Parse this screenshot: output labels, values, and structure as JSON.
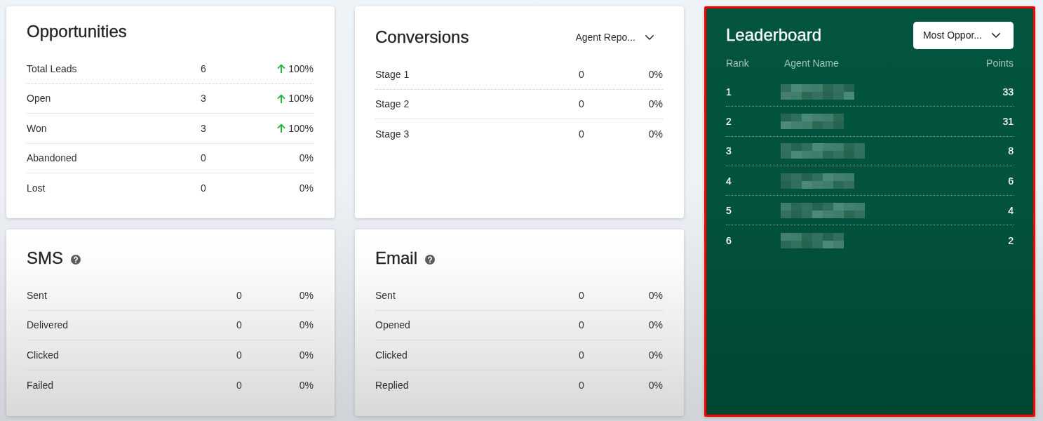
{
  "cards": [
    {
      "kind": "stats",
      "title": "Opportunities",
      "help": false,
      "rows": [
        {
          "label": "Total Leads",
          "count": "6",
          "percent": "100%",
          "trend_up": true
        },
        {
          "label": "Open",
          "count": "3",
          "percent": "100%",
          "trend_up": true
        },
        {
          "label": "Won",
          "count": "3",
          "percent": "100%",
          "trend_up": true
        },
        {
          "label": "Abandoned",
          "count": "0",
          "percent": "0%",
          "trend_up": false
        },
        {
          "label": "Lost",
          "count": "0",
          "percent": "0%",
          "trend_up": false
        }
      ]
    },
    {
      "kind": "stats",
      "title": "Conversions",
      "help": false,
      "dropdown": {
        "value": "Agent Repo..."
      },
      "rows": [
        {
          "label": "Stage 1",
          "count": "0",
          "percent": "0%",
          "trend_up": false
        },
        {
          "label": "Stage 2",
          "count": "0",
          "percent": "0%",
          "trend_up": false
        },
        {
          "label": "Stage 3",
          "count": "0",
          "percent": "0%",
          "trend_up": false
        }
      ]
    },
    {
      "kind": "leaderboard",
      "title": "Leaderboard",
      "highlighted": true,
      "dropdown": {
        "value": "Most Oppor..."
      },
      "columns": [
        "Rank",
        "Agent Name",
        "Points"
      ],
      "rows": [
        {
          "rank": "1",
          "points": "33"
        },
        {
          "rank": "2",
          "points": "31"
        },
        {
          "rank": "3",
          "points": "8"
        },
        {
          "rank": "4",
          "points": "6"
        },
        {
          "rank": "5",
          "points": "4"
        },
        {
          "rank": "6",
          "points": "2"
        }
      ]
    },
    {
      "kind": "stats",
      "title": "SMS",
      "help": true,
      "rows": [
        {
          "label": "Sent",
          "count": "0",
          "percent": "0%",
          "trend_up": false
        },
        {
          "label": "Delivered",
          "count": "0",
          "percent": "0%",
          "trend_up": false
        },
        {
          "label": "Clicked",
          "count": "0",
          "percent": "0%",
          "trend_up": false
        },
        {
          "label": "Failed",
          "count": "0",
          "percent": "0%",
          "trend_up": false
        }
      ]
    },
    {
      "kind": "stats",
      "title": "Email",
      "help": true,
      "rows": [
        {
          "label": "Sent",
          "count": "0",
          "percent": "0%",
          "trend_up": false
        },
        {
          "label": "Opened",
          "count": "0",
          "percent": "0%",
          "trend_up": false
        },
        {
          "label": "Clicked",
          "count": "0",
          "percent": "0%",
          "trend_up": false
        },
        {
          "label": "Replied",
          "count": "0",
          "percent": "0%",
          "trend_up": false
        }
      ]
    }
  ]
}
